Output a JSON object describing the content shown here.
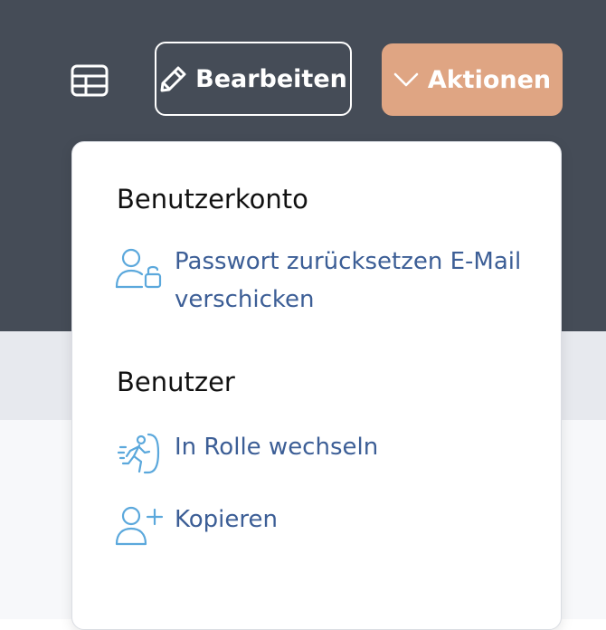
{
  "toolbar": {
    "table_icon": "table-icon",
    "edit_label": "Bearbeiten",
    "edit_icon": "pencil-icon",
    "actions_label": "Aktionen",
    "actions_icon": "chevron-down-icon",
    "actions_color": "#dfa583",
    "background_color": "#454c57"
  },
  "menu": {
    "sections": [
      {
        "title": "Benutzerkonto",
        "items": [
          {
            "label": "Passwort zurücksetzen E-Mail verschicken",
            "icon": "user-lock-icon"
          }
        ]
      },
      {
        "title": "Benutzer",
        "items": [
          {
            "label": "In Rolle wechseln",
            "icon": "person-walking-door-icon"
          },
          {
            "label": "Kopieren",
            "icon": "user-plus-icon"
          }
        ]
      }
    ],
    "link_color": "#3c5e96",
    "icon_color": "#5ba8dc"
  }
}
